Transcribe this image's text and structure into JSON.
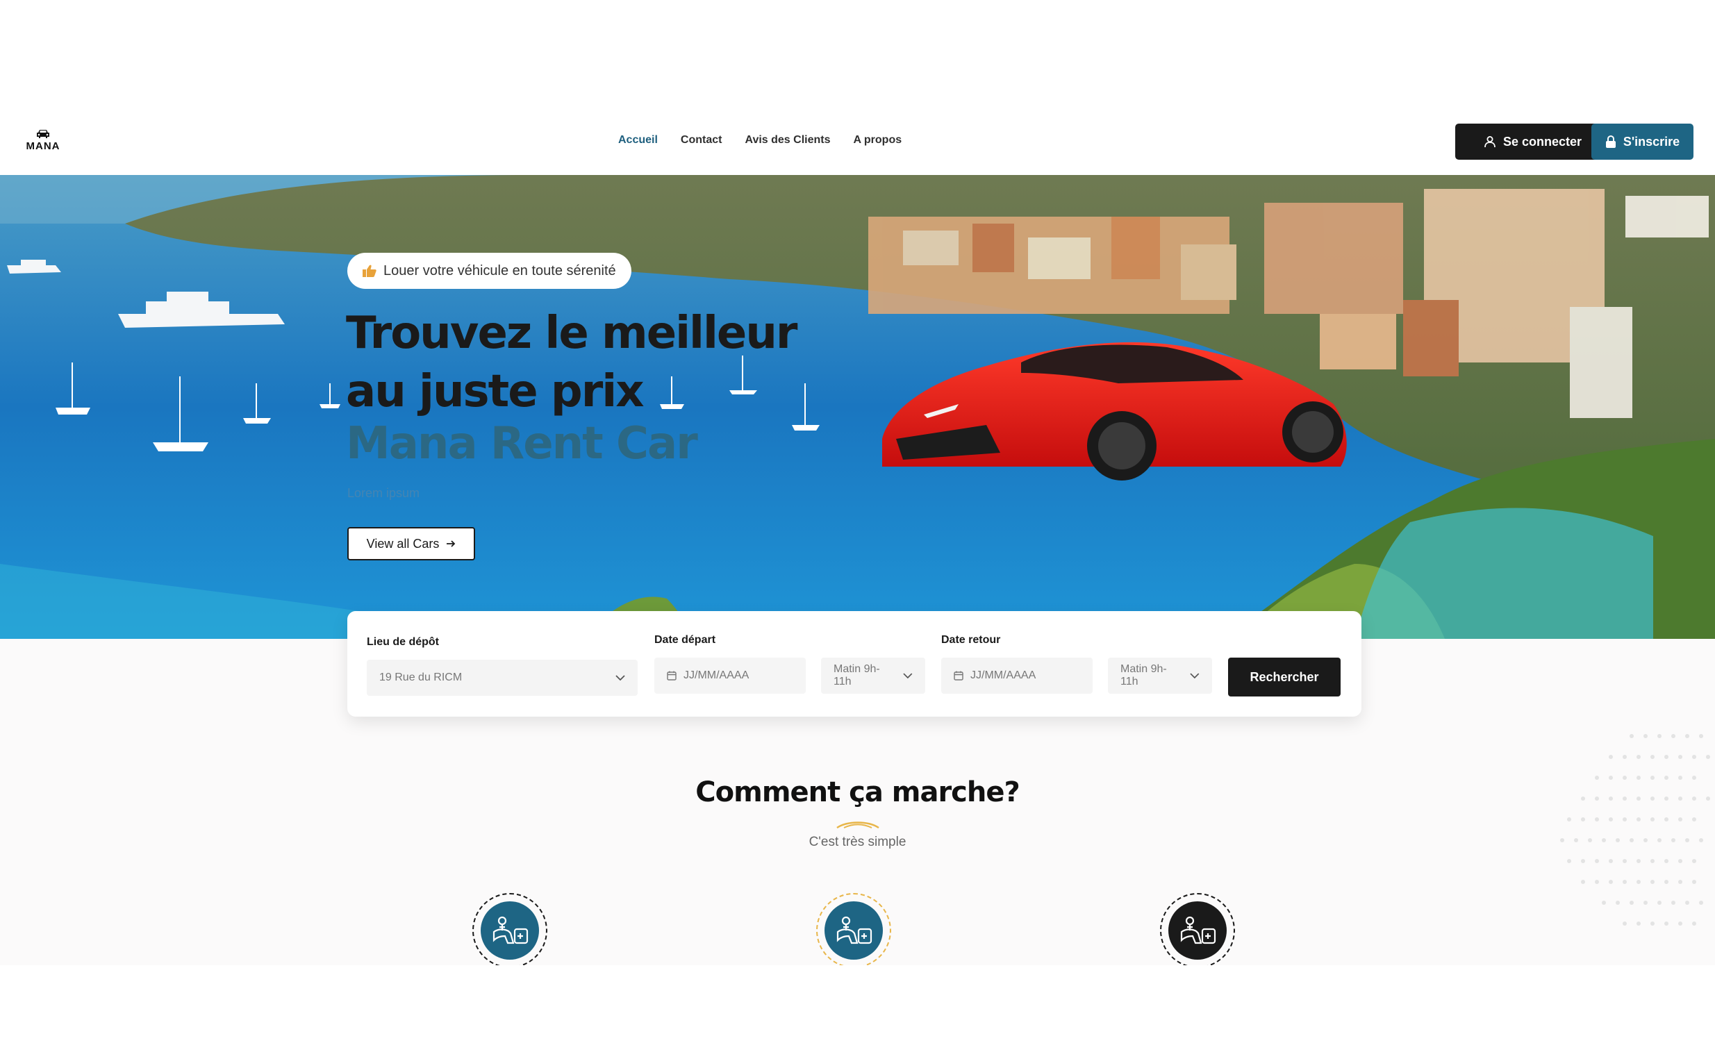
{
  "brand": {
    "logo_text": "MANA"
  },
  "nav": {
    "items": [
      {
        "label": "Accueil",
        "active": true
      },
      {
        "label": "Contact",
        "active": false
      },
      {
        "label": "Avis des Clients",
        "active": false
      },
      {
        "label": "A propos",
        "active": false
      }
    ]
  },
  "auth": {
    "login_label": "Se connecter",
    "signup_label": "S'inscrire"
  },
  "hero": {
    "badge_text": "Louer votre véhicule en toute sérenité",
    "title": "Trouvez le meilleur au juste prix",
    "brand_line": "Mana Rent Car",
    "subtitle": "Lorem ipsum",
    "cta_label": "View all Cars"
  },
  "search": {
    "pickup": {
      "label": "Lieu de dépôt",
      "value": "19 Rue du RICM"
    },
    "depart": {
      "label": "Date départ",
      "placeholder": "JJ/MM/AAAA",
      "time": "Matin 9h-11h"
    },
    "return": {
      "label": "Date retour",
      "placeholder": "JJ/MM/AAAA",
      "time": "Matin 9h-11h"
    },
    "button_label": "Rechercher"
  },
  "how": {
    "title": "Comment ça marche?",
    "subtitle": "C'est très simple"
  },
  "colors": {
    "accent": "#1e6584",
    "nav_active": "#1e5f7e",
    "dark": "#1a1a1a",
    "gold": "#e8b64a"
  },
  "icons": [
    "car-logo-icon",
    "user-icon",
    "lock-icon",
    "thumbs-up-icon",
    "arrow-right-icon",
    "calendar-icon",
    "chevron-down-icon",
    "key-car-icon"
  ]
}
